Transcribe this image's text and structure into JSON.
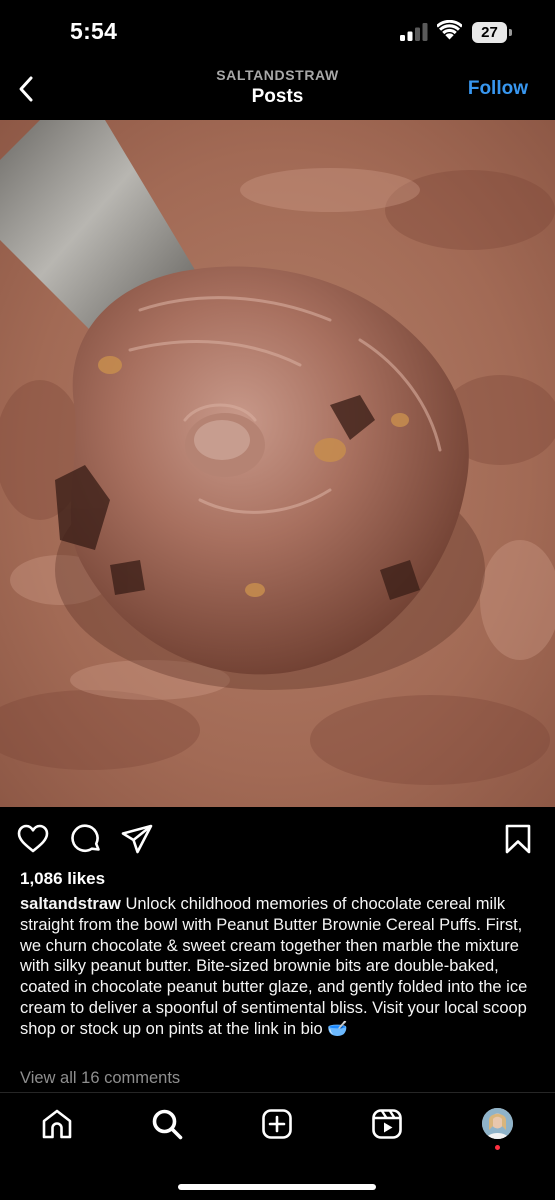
{
  "status_bar": {
    "time": "5:54",
    "battery": "27"
  },
  "header": {
    "account": "SALTANDSTRAW",
    "title": "Posts",
    "follow_label": "Follow",
    "back_icon": "chevron-left-icon"
  },
  "post": {
    "image_subject": "chocolate ice cream scoop",
    "likes": "1,086 likes",
    "username": "saltandstraw",
    "caption": "Unlock childhood memories of chocolate cereal milk straight from the bowl with Peanut Butter Brownie Cereal Puffs. First, we churn chocolate & sweet cream together then marble the mixture with silky peanut butter. Bite-sized brownie bits are double-baked, coated in chocolate peanut butter glaze, and gently folded into the ice cream to deliver a spoonful of sentimental bliss. Visit your local scoop shop or stock up on pints at the link in bio 🥣",
    "comments_link": "View all 16 comments",
    "actions": [
      "heart-icon",
      "comment-icon",
      "share-icon",
      "bookmark-icon"
    ]
  },
  "bottom_nav": {
    "items": [
      "home-icon",
      "search-icon",
      "create-icon",
      "reels-icon",
      "profile-avatar"
    ],
    "active": "search-icon"
  },
  "colors": {
    "background": "#000000",
    "accent": "#3897f0",
    "secondary_text": "#8e8e8e",
    "notification": "#ff3040"
  }
}
